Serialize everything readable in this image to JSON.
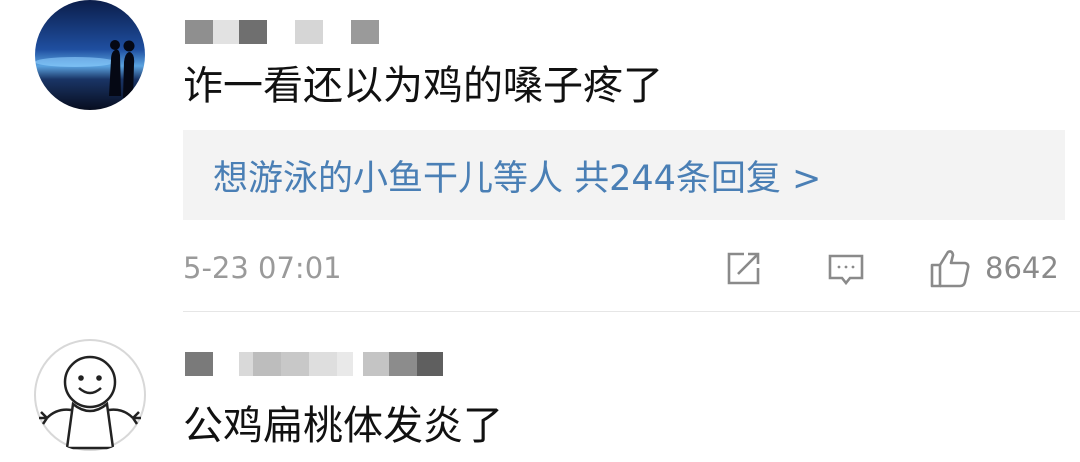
{
  "comments": [
    {
      "text": "诈一看还以为鸡的嗓子疼了",
      "replies_summary": "想游泳的小鱼干儿等人  共244条回复 >",
      "time": "5-23 07:01",
      "likes": "8642"
    },
    {
      "text": "公鸡扁桃体发炎了"
    }
  ],
  "icons": {
    "share": "share-icon",
    "comment": "comment-icon",
    "like": "thumbs-up-icon"
  },
  "colors": {
    "link": "#4a7fb5",
    "meta": "#9a9a9a",
    "reply_bg": "#f3f3f3"
  }
}
